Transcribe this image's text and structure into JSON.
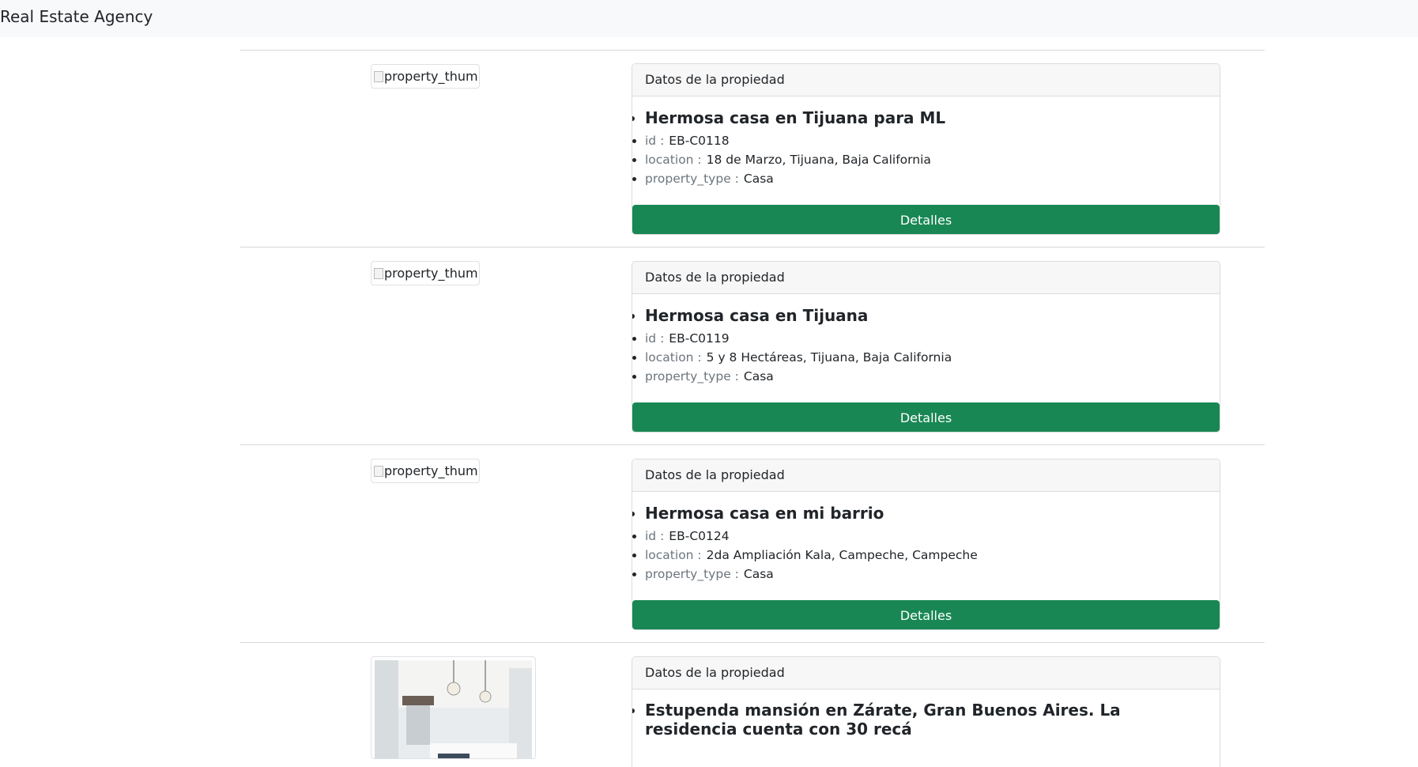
{
  "navbar": {
    "brand": "Real Estate Agency"
  },
  "thumb_alt": "property_thumb",
  "card_header": "Datos de la propiedad",
  "button_label": "Detalles",
  "properties": [
    {
      "title": "Hermosa casa en Tijuana para ML",
      "id_label": "id :",
      "id": "EB-C0118",
      "location_label": "location :",
      "location": "18 de Marzo, Tijuana, Baja California",
      "type_label": "property_type :",
      "property_type": "Casa"
    },
    {
      "title": "Hermosa casa en Tijuana",
      "id_label": "id :",
      "id": "EB-C0119",
      "location_label": "location :",
      "location": "5 y 8 Hectáreas, Tijuana, Baja California",
      "type_label": "property_type :",
      "property_type": "Casa"
    },
    {
      "title": "Hermosa casa en mi barrio",
      "id_label": "id :",
      "id": "EB-C0124",
      "location_label": "location :",
      "location": "2da Ampliación Kala, Campeche, Campeche",
      "type_label": "property_type :",
      "property_type": "Casa"
    },
    {
      "title": "Estupenda mansión en Zárate, Gran Buenos Aires. La residencia cuenta con 30 recá"
    }
  ]
}
